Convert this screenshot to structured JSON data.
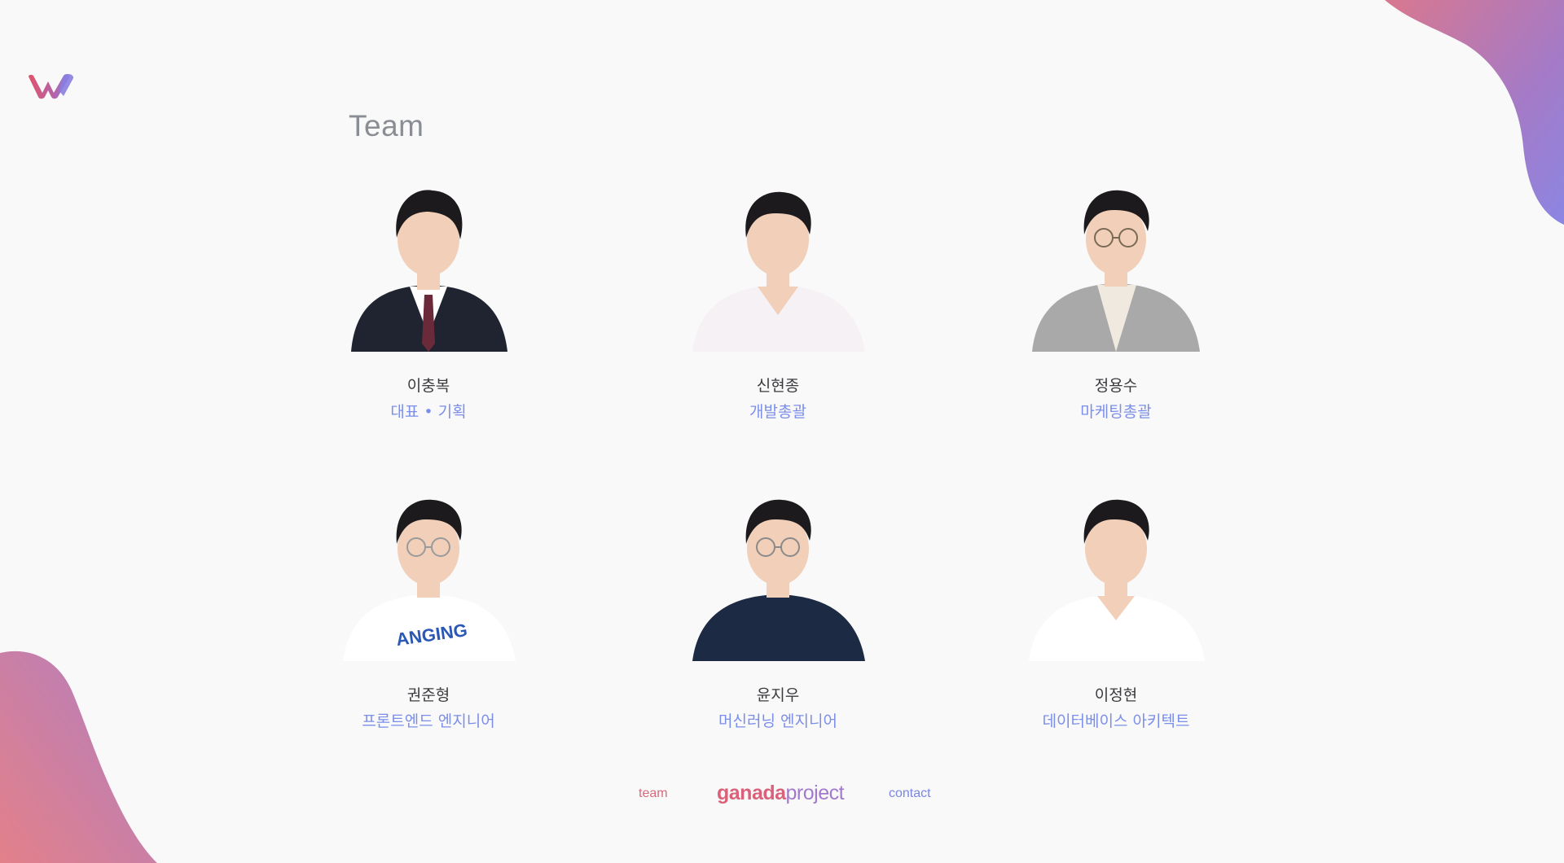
{
  "header": {
    "logo_icon": "w-logo-icon",
    "title": "Team"
  },
  "team": [
    {
      "name": "이충복",
      "role": "대표 • 기획",
      "attire": "suit",
      "shirt": "#ffffff",
      "jacket": "#1f2430",
      "glasses": false
    },
    {
      "name": "신현종",
      "role": "개발총괄",
      "attire": "shirt",
      "shirt": "#f6f1f4",
      "jacket": "",
      "glasses": false
    },
    {
      "name": "정용수",
      "role": "마케팅총괄",
      "attire": "blazer",
      "shirt": "#efe9df",
      "jacket": "#a9a9a9",
      "glasses": true
    },
    {
      "name": "권준형",
      "role": "프론트엔드 엔지니어",
      "attire": "tshirt",
      "shirt": "#ffffff",
      "jacket": "",
      "glasses": true
    },
    {
      "name": "윤지우",
      "role": "머신러닝 엔지니어",
      "attire": "tshirt",
      "shirt": "#1d2a44",
      "jacket": "",
      "glasses": true
    },
    {
      "name": "이정현",
      "role": "데이터베이스 아키텍트",
      "attire": "shirt",
      "shirt": "#ffffff",
      "jacket": "",
      "glasses": false
    }
  ],
  "footer": {
    "team_link": "team",
    "brand_bold": "ganada",
    "brand_light": "project",
    "contact_link": "contact"
  },
  "colors": {
    "accent_pink": "#d9627a",
    "accent_blue": "#7b8ee8",
    "accent_purple": "#a27acb",
    "background": "#f9f9fa",
    "skin": "#f1cfb9",
    "hair": "#1c1a1c"
  }
}
